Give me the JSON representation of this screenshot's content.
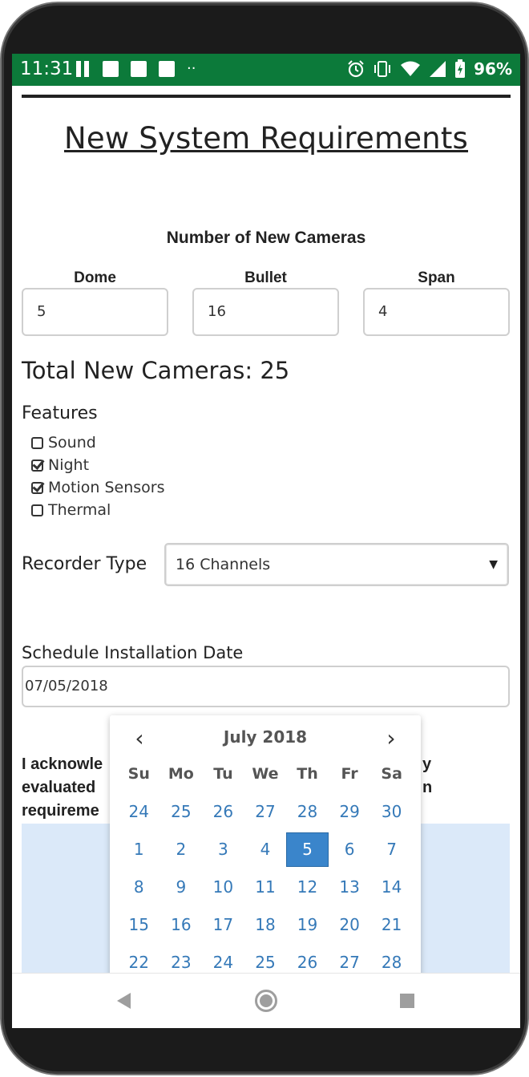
{
  "status_bar": {
    "time": "11:31",
    "dots": "··",
    "battery": "96%",
    "icons": [
      "pause-icon",
      "image-icon",
      "gmail-icon",
      "document-icon",
      "alarm-icon",
      "vibrate-icon",
      "wifi-icon",
      "signal-icon",
      "battery-icon"
    ],
    "color": "#0c7a3a"
  },
  "page": {
    "title": "New System Requirements",
    "cameras_heading": "Number of New Cameras",
    "cameras": [
      {
        "label": "Dome",
        "value": "5"
      },
      {
        "label": "Bullet",
        "value": "16"
      },
      {
        "label": "Span",
        "value": "4"
      }
    ],
    "total": "Total New Cameras: 25",
    "features_heading": "Features",
    "features": [
      {
        "label": "Sound",
        "checked": false
      },
      {
        "label": "Night",
        "checked": true
      },
      {
        "label": "Motion Sensors",
        "checked": true
      },
      {
        "label": "Thermal",
        "checked": false
      }
    ],
    "recorder_label": "Recorder Type",
    "recorder_value": "16 Channels",
    "recorder_arrow": "▼",
    "schedule_label": "Schedule Installation Date",
    "date_value": "07/05/2018",
    "ack_lines": [
      {
        "left": "I acknowle",
        "right": "y"
      },
      {
        "left": "evaluated",
        "right": "n"
      },
      {
        "left": "requireme",
        "right": ""
      }
    ],
    "panel_color": "#dbe9f9"
  },
  "datepicker": {
    "prev": "‹",
    "next": "›",
    "month": "July 2018",
    "dow": [
      "Su",
      "Mo",
      "Tu",
      "We",
      "Th",
      "Fr",
      "Sa"
    ],
    "weeks": [
      [
        "24",
        "25",
        "26",
        "27",
        "28",
        "29",
        "30"
      ],
      [
        "1",
        "2",
        "3",
        "4",
        "5",
        "6",
        "7"
      ],
      [
        "8",
        "9",
        "10",
        "11",
        "12",
        "13",
        "14"
      ],
      [
        "15",
        "16",
        "17",
        "18",
        "19",
        "20",
        "21"
      ],
      [
        "22",
        "23",
        "24",
        "25",
        "26",
        "27",
        "28"
      ]
    ],
    "selected": "5",
    "accent": "#3a85cb"
  }
}
